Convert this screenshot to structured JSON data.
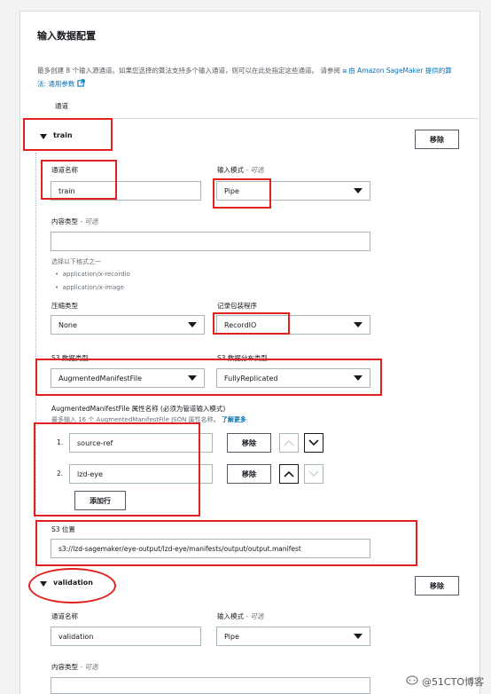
{
  "panel": {
    "title": "输入数据配置",
    "description": "最多创建 8 个输入源通道。如果您选择的算法支持多个输入通道，则可以在此处指定这些通道。 请参阅",
    "link_text": "由 Amazon SageMaker 提供的算法: 通用参数",
    "channels_header": "通道"
  },
  "train": {
    "name": "train",
    "remove_label": "移除",
    "channel_name_label": "通道名称",
    "channel_name_value": "train",
    "input_mode_label": "输入模式",
    "optional": "- 可选",
    "input_mode_value": "Pipe",
    "content_type_label": "内容类型",
    "content_type_value": "",
    "content_type_hint": "选择以下格式之一",
    "content_type_options": [
      "application/x-recordio",
      "application/x-image"
    ],
    "compression_label": "压缩类型",
    "compression_value": "None",
    "record_wrapper_label": "记录包装程序",
    "record_wrapper_value": "RecordIO",
    "s3_data_type_label": "S3 数据类型",
    "s3_data_type_value": "AugmentedManifestFile",
    "s3_distribution_label": "S3 数据分布类型",
    "s3_distribution_value": "FullyReplicated",
    "attr_names_label": "AugmentedManifestFile 属性名称 (必须为管道输入模式)",
    "attr_names_hint": "最多输入 16 个 AugmentedManifestFile JSON 属性名称。",
    "attr_names_link": "了解更多",
    "attributes": [
      {
        "index": "1.",
        "value": "source-ref",
        "remove_label": "移除"
      },
      {
        "index": "2.",
        "value": "lzd-eye",
        "remove_label": "移除"
      }
    ],
    "add_row_label": "添加行",
    "s3_location_label": "S3 位置",
    "s3_location_value": "s3://lzd-sagemaker/eye-output/lzd-eye/manifests/output/output.manifest"
  },
  "validation": {
    "name": "validation",
    "remove_label": "移除",
    "channel_name_label": "通道名称",
    "channel_name_value": "validation",
    "input_mode_label": "输入模式",
    "optional": "- 可选",
    "input_mode_value": "Pipe",
    "content_type_label": "内容类型",
    "content_type_value": ""
  },
  "watermark": "@51CTO博客",
  "colors": {
    "annotation": "#e0211f",
    "link": "#0073bb"
  }
}
